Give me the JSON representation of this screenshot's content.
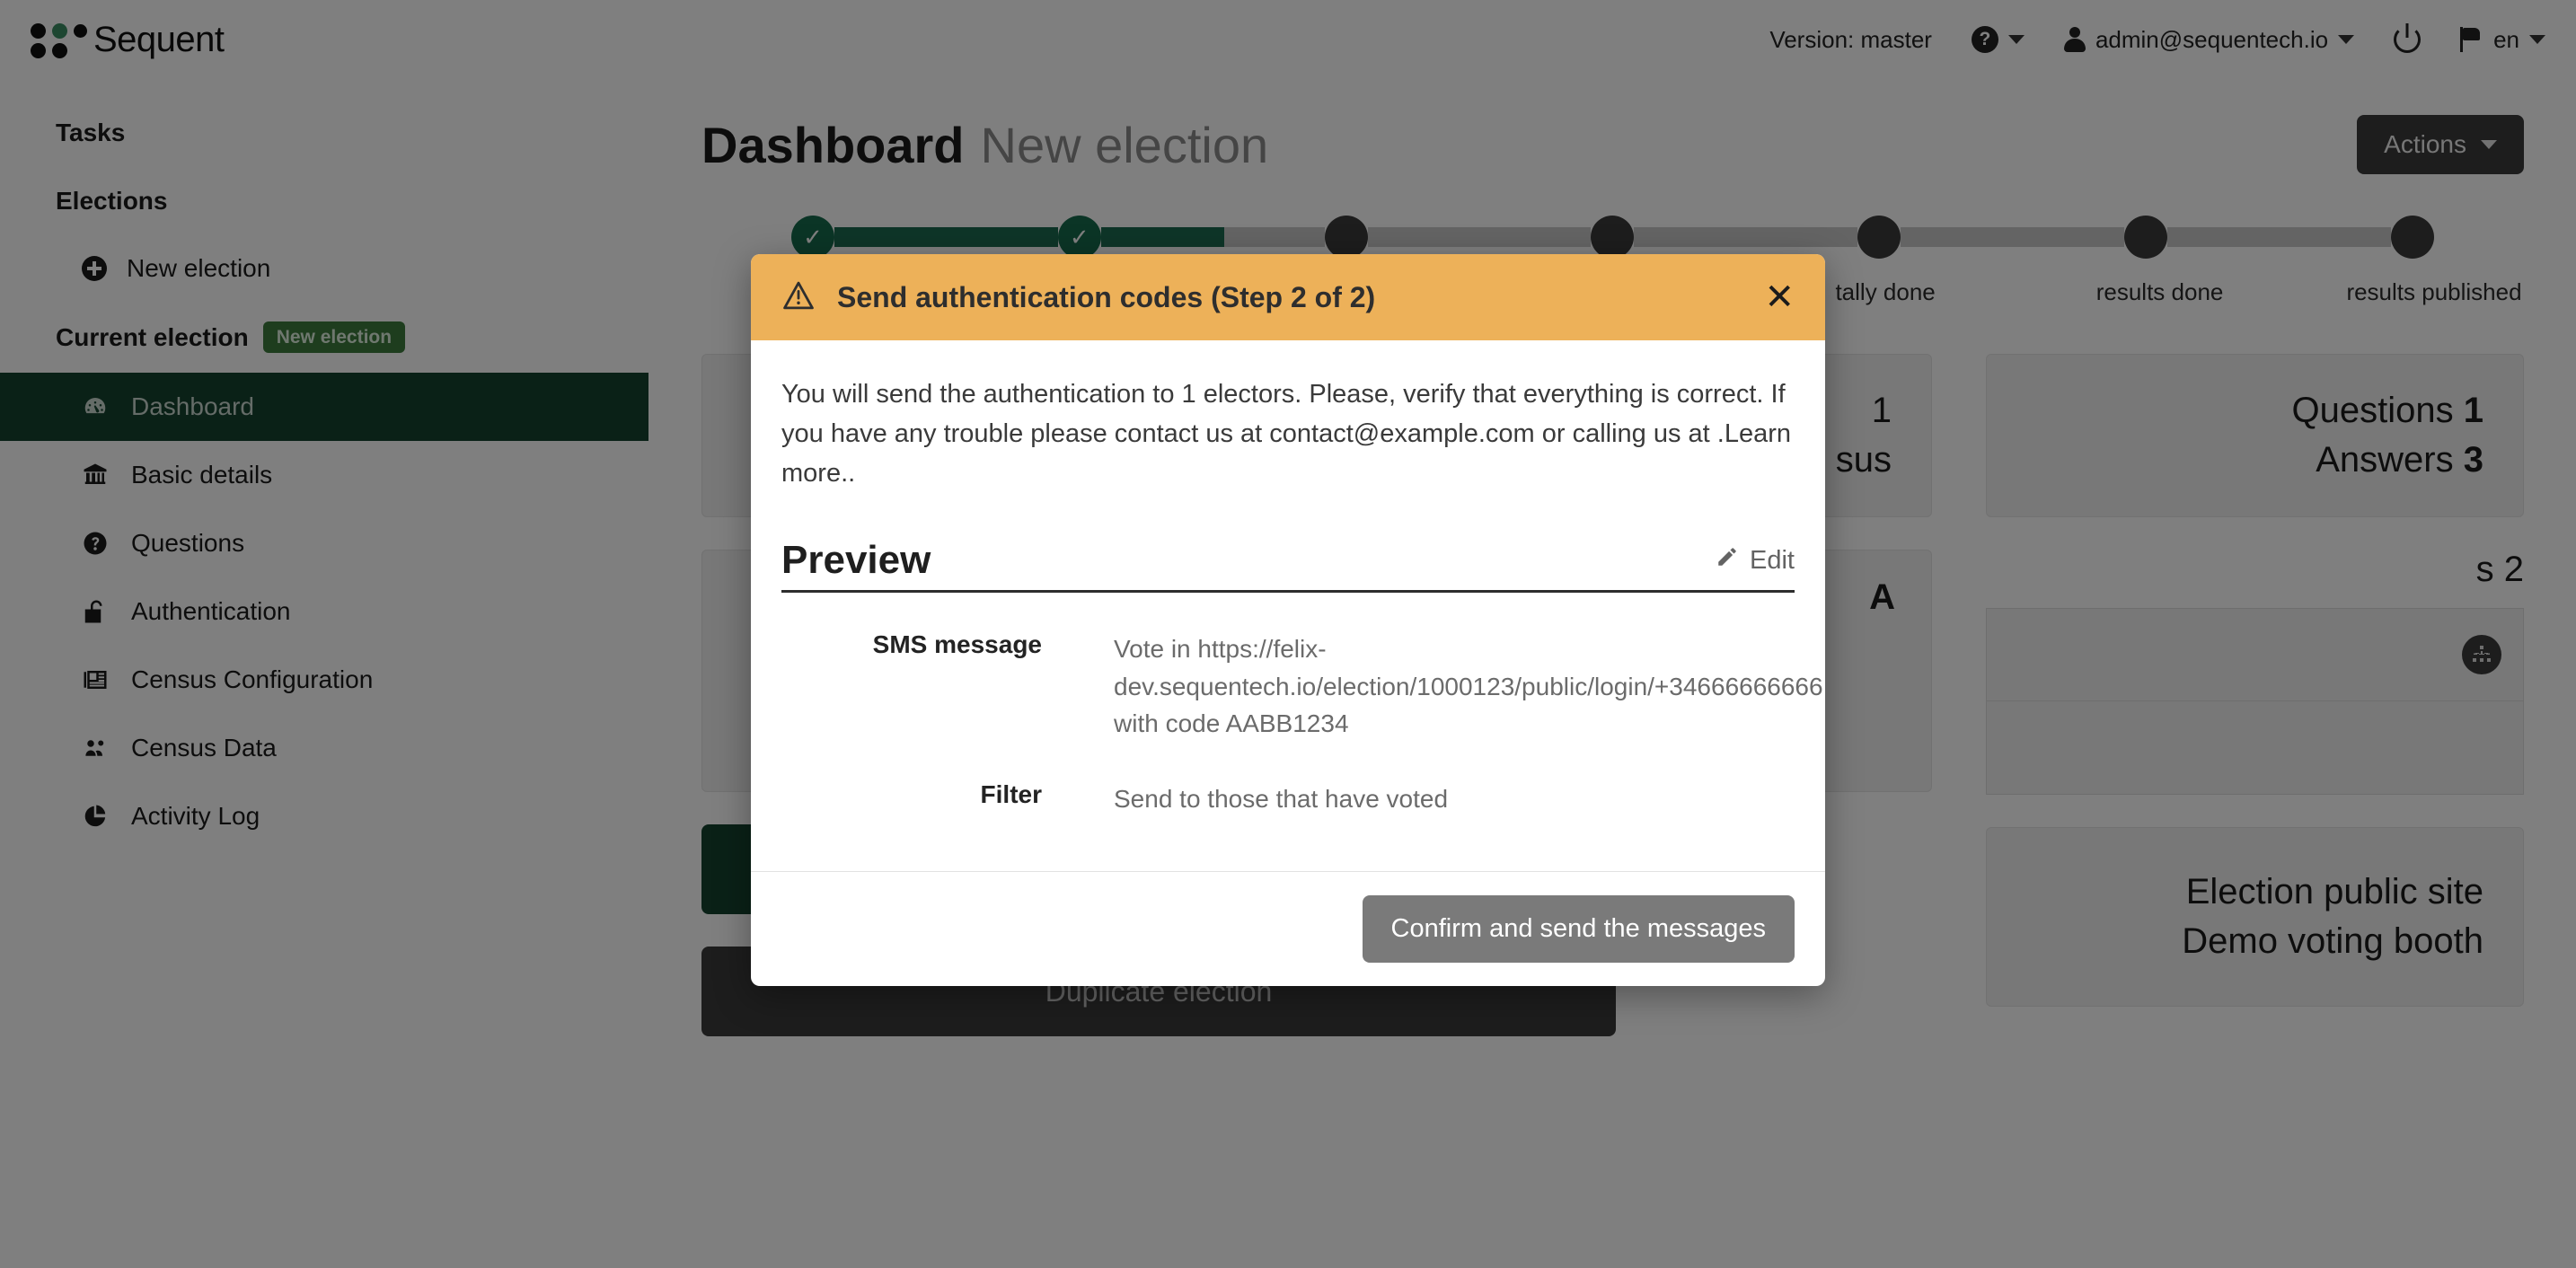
{
  "brand": {
    "name": "Sequent"
  },
  "topbar": {
    "version": "Version: master",
    "help_icon": "question-circle-icon",
    "account": "admin@sequentech.io",
    "power_icon": "power-icon",
    "language": "en"
  },
  "sidebar": {
    "tasks_label": "Tasks",
    "elections_label": "Elections",
    "new_election_label": "New election",
    "current_election_label": "Current election",
    "current_election_badge": "New election",
    "items": [
      {
        "label": "Dashboard",
        "icon": "dashboard-icon",
        "active": true
      },
      {
        "label": "Basic details",
        "icon": "bank-icon",
        "active": false
      },
      {
        "label": "Questions",
        "icon": "question-circle-icon",
        "active": false
      },
      {
        "label": "Authentication",
        "icon": "unlock-icon",
        "active": false
      },
      {
        "label": "Census Configuration",
        "icon": "newspaper-icon",
        "active": false
      },
      {
        "label": "Census Data",
        "icon": "users-icon",
        "active": false
      },
      {
        "label": "Activity Log",
        "icon": "pie-chart-icon",
        "active": false
      }
    ]
  },
  "main": {
    "title": "Dashboard",
    "subtitle": "New election",
    "actions_label": "Actions",
    "stepper": {
      "nodes": [
        {
          "state": "done",
          "label": ""
        },
        {
          "state": "done",
          "label": ""
        },
        {
          "state": "pending",
          "label": ""
        },
        {
          "state": "pending",
          "label": ""
        },
        {
          "state": "pending",
          "label": "tally done"
        },
        {
          "state": "pending",
          "label": "results done"
        },
        {
          "state": "pending",
          "label": "results published"
        }
      ],
      "bars": [
        100,
        55,
        0,
        0,
        0,
        0
      ]
    },
    "cards": {
      "census_stat_value": "1",
      "census_stat_label": "sus",
      "questions_label": "Questions",
      "questions_value": "1",
      "answers_label": "Answers",
      "answers_value": "3",
      "left_panel_letter": "A",
      "right_panel_label": "s 2",
      "tree_icon": "org-tree-icon",
      "duplicate_election_label": "Duplicate election",
      "public_site_label": "Election public site",
      "demo_booth_label": "Demo voting booth"
    }
  },
  "modal": {
    "title": "Send authentication codes (Step 2 of 2)",
    "warning_icon": "warning-triangle-icon",
    "close_icon": "close-icon",
    "body_text": "You will send the authentication to 1 electors. Please, verify that everything is correct. If you have any trouble please contact us at contact@example.com or calling us at .Learn more..",
    "preview_heading": "Preview",
    "edit_label": "Edit",
    "edit_icon": "pencil-icon",
    "fields": [
      {
        "term": "SMS message",
        "value": "Vote in https://felix-dev.sequentech.io/election/1000123/public/login/+34666666666 with code AABB1234"
      },
      {
        "term": "Filter",
        "value": "Send to those that have voted"
      }
    ],
    "confirm_label": "Confirm and send the messages"
  },
  "colors": {
    "header_warning": "#edb159",
    "brand_green": "#3a8c63",
    "active_green": "#14422f",
    "step_done": "#176b4d",
    "dark_button": "#3b3b3b"
  }
}
